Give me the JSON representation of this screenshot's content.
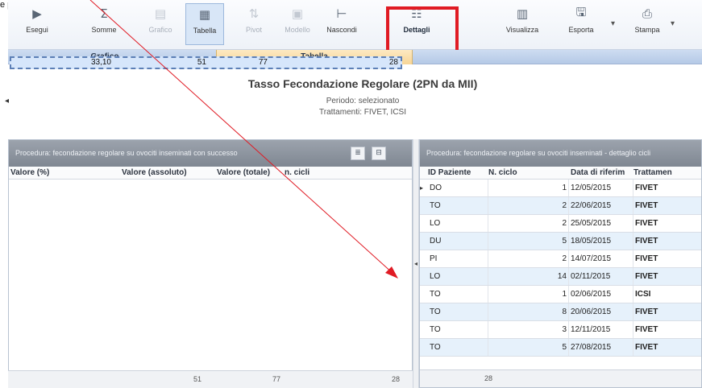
{
  "top_annotation": {
    "left": "e p",
    "right": ""
  },
  "toolbar": {
    "buttons": [
      {
        "label": "Esegui",
        "icon": "play-icon"
      },
      {
        "label": "Somme",
        "icon": "sum-icon"
      },
      {
        "label": "Grafico",
        "icon": "chart-icon"
      },
      {
        "label": "Tabella",
        "icon": "table-icon"
      },
      {
        "label": "Pivot",
        "icon": "pivot-icon"
      },
      {
        "label": "Modello",
        "icon": "model-icon"
      },
      {
        "label": "Nascondi",
        "icon": "hide-icon"
      },
      {
        "label": "Dettagli",
        "icon": "details-icon"
      },
      {
        "label": "Visualizza",
        "icon": "view-icon"
      },
      {
        "label": "Esporta",
        "icon": "save-icon"
      },
      {
        "label": "Stampa",
        "icon": "print-icon"
      }
    ],
    "glyphs": {
      "play": "▶",
      "sum": "Σ",
      "chart": "▤",
      "table": "▦",
      "pivot": "⇅",
      "model": "▣",
      "hide": "⊢",
      "details": "☷",
      "view": "▥",
      "save": "🖫",
      "print": "⎙",
      "caret": "▾"
    }
  },
  "tabs": {
    "grafico": "Grafico",
    "tabella": "Tabella"
  },
  "report": {
    "title": "Tasso Fecondazione Regolare (2PN da MII)",
    "line1": "Periodo: selezionato",
    "line2": "Trattamenti: FIVET, ICSI"
  },
  "left_panel": {
    "header": "Procedura: fecondazione regolare su ovociti inseminati con successo",
    "btn_a": "≣",
    "btn_b": "⊟",
    "columns": [
      "Valore (%)",
      "Valore (assoluto)",
      "Valore (totale)",
      "n. cicli"
    ],
    "row": {
      "pct": "33,10",
      "abs": "51",
      "tot": "77",
      "cycles": "28"
    },
    "footer": {
      "abs": "51",
      "tot": "77",
      "cycles": "28"
    }
  },
  "right_panel": {
    "header": "Procedura: fecondazione regolare su ovociti inseminati - dettaglio cicli",
    "columns": [
      "ID Paziente",
      "N. ciclo",
      "Data di riferim",
      "Trattamen"
    ],
    "rows": [
      {
        "id": "DO",
        "n": "1",
        "date": "12/05/2015",
        "t": "FIVET"
      },
      {
        "id": "TO",
        "n": "2",
        "date": "22/06/2015",
        "t": "FIVET"
      },
      {
        "id": "LO",
        "n": "2",
        "date": "25/05/2015",
        "t": "FIVET"
      },
      {
        "id": "DU",
        "n": "5",
        "date": "18/05/2015",
        "t": "FIVET"
      },
      {
        "id": "PI",
        "n": "2",
        "date": "14/07/2015",
        "t": "FIVET"
      },
      {
        "id": "LO",
        "n": "14",
        "date": "02/11/2015",
        "t": "FIVET"
      },
      {
        "id": "TO",
        "n": "1",
        "date": "02/06/2015",
        "t": "ICSI"
      },
      {
        "id": "TO",
        "n": "8",
        "date": "20/06/2015",
        "t": "FIVET"
      },
      {
        "id": "TO",
        "n": "3",
        "date": "12/11/2015",
        "t": "FIVET"
      },
      {
        "id": "TO",
        "n": "5",
        "date": "27/08/2015",
        "t": "FIVET"
      }
    ],
    "footer": {
      "count": "28"
    }
  },
  "colors": {
    "annotation": "#e01b24",
    "selected_row": "#d6e6fb",
    "active_tab": "#f7d596"
  }
}
